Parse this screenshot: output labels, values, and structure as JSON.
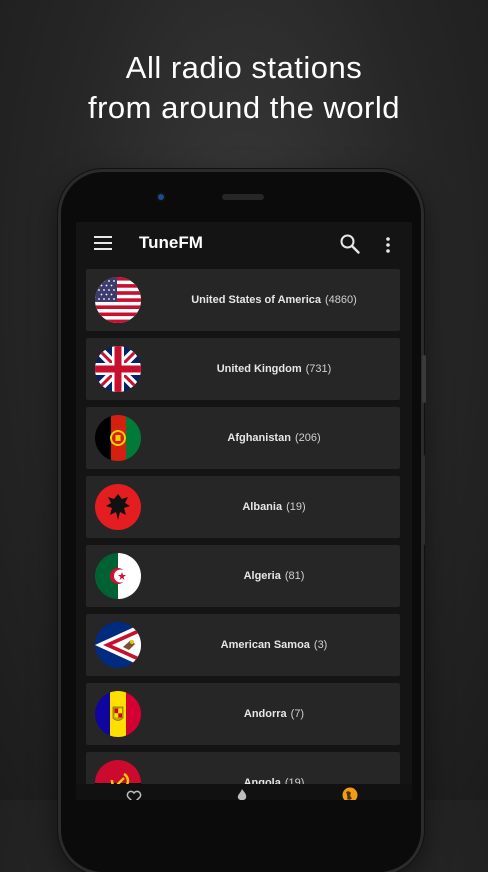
{
  "headline": {
    "line1": "All radio stations",
    "line2": "from around the world"
  },
  "appbar": {
    "title": "TuneFM",
    "menu_icon": "hamburger-menu-icon",
    "search_icon": "search-icon",
    "more_icon": "more-vert-icon"
  },
  "countries": [
    {
      "name": "United States of America",
      "count": "(4860)",
      "flag_icon": "usa-flag-icon"
    },
    {
      "name": "United Kingdom",
      "count": "(731)",
      "flag_icon": "uk-flag-icon"
    },
    {
      "name": "Afghanistan",
      "count": "(206)",
      "flag_icon": "afghanistan-flag-icon"
    },
    {
      "name": "Albania",
      "count": "(19)",
      "flag_icon": "albania-flag-icon"
    },
    {
      "name": "Algeria",
      "count": "(81)",
      "flag_icon": "algeria-flag-icon"
    },
    {
      "name": "American Samoa",
      "count": "(3)",
      "flag_icon": "american-samoa-flag-icon"
    },
    {
      "name": "Andorra",
      "count": "(7)",
      "flag_icon": "andorra-flag-icon"
    },
    {
      "name": "Angola",
      "count": "(19)",
      "flag_icon": "angola-flag-icon"
    }
  ],
  "bottomnav": {
    "items": [
      "heart-icon",
      "flame-icon",
      "globe-icon"
    ],
    "active": "globe-icon",
    "active_color": "#f39c12"
  },
  "colors": {
    "card_bg": "#262626",
    "screen_bg": "#141414"
  }
}
